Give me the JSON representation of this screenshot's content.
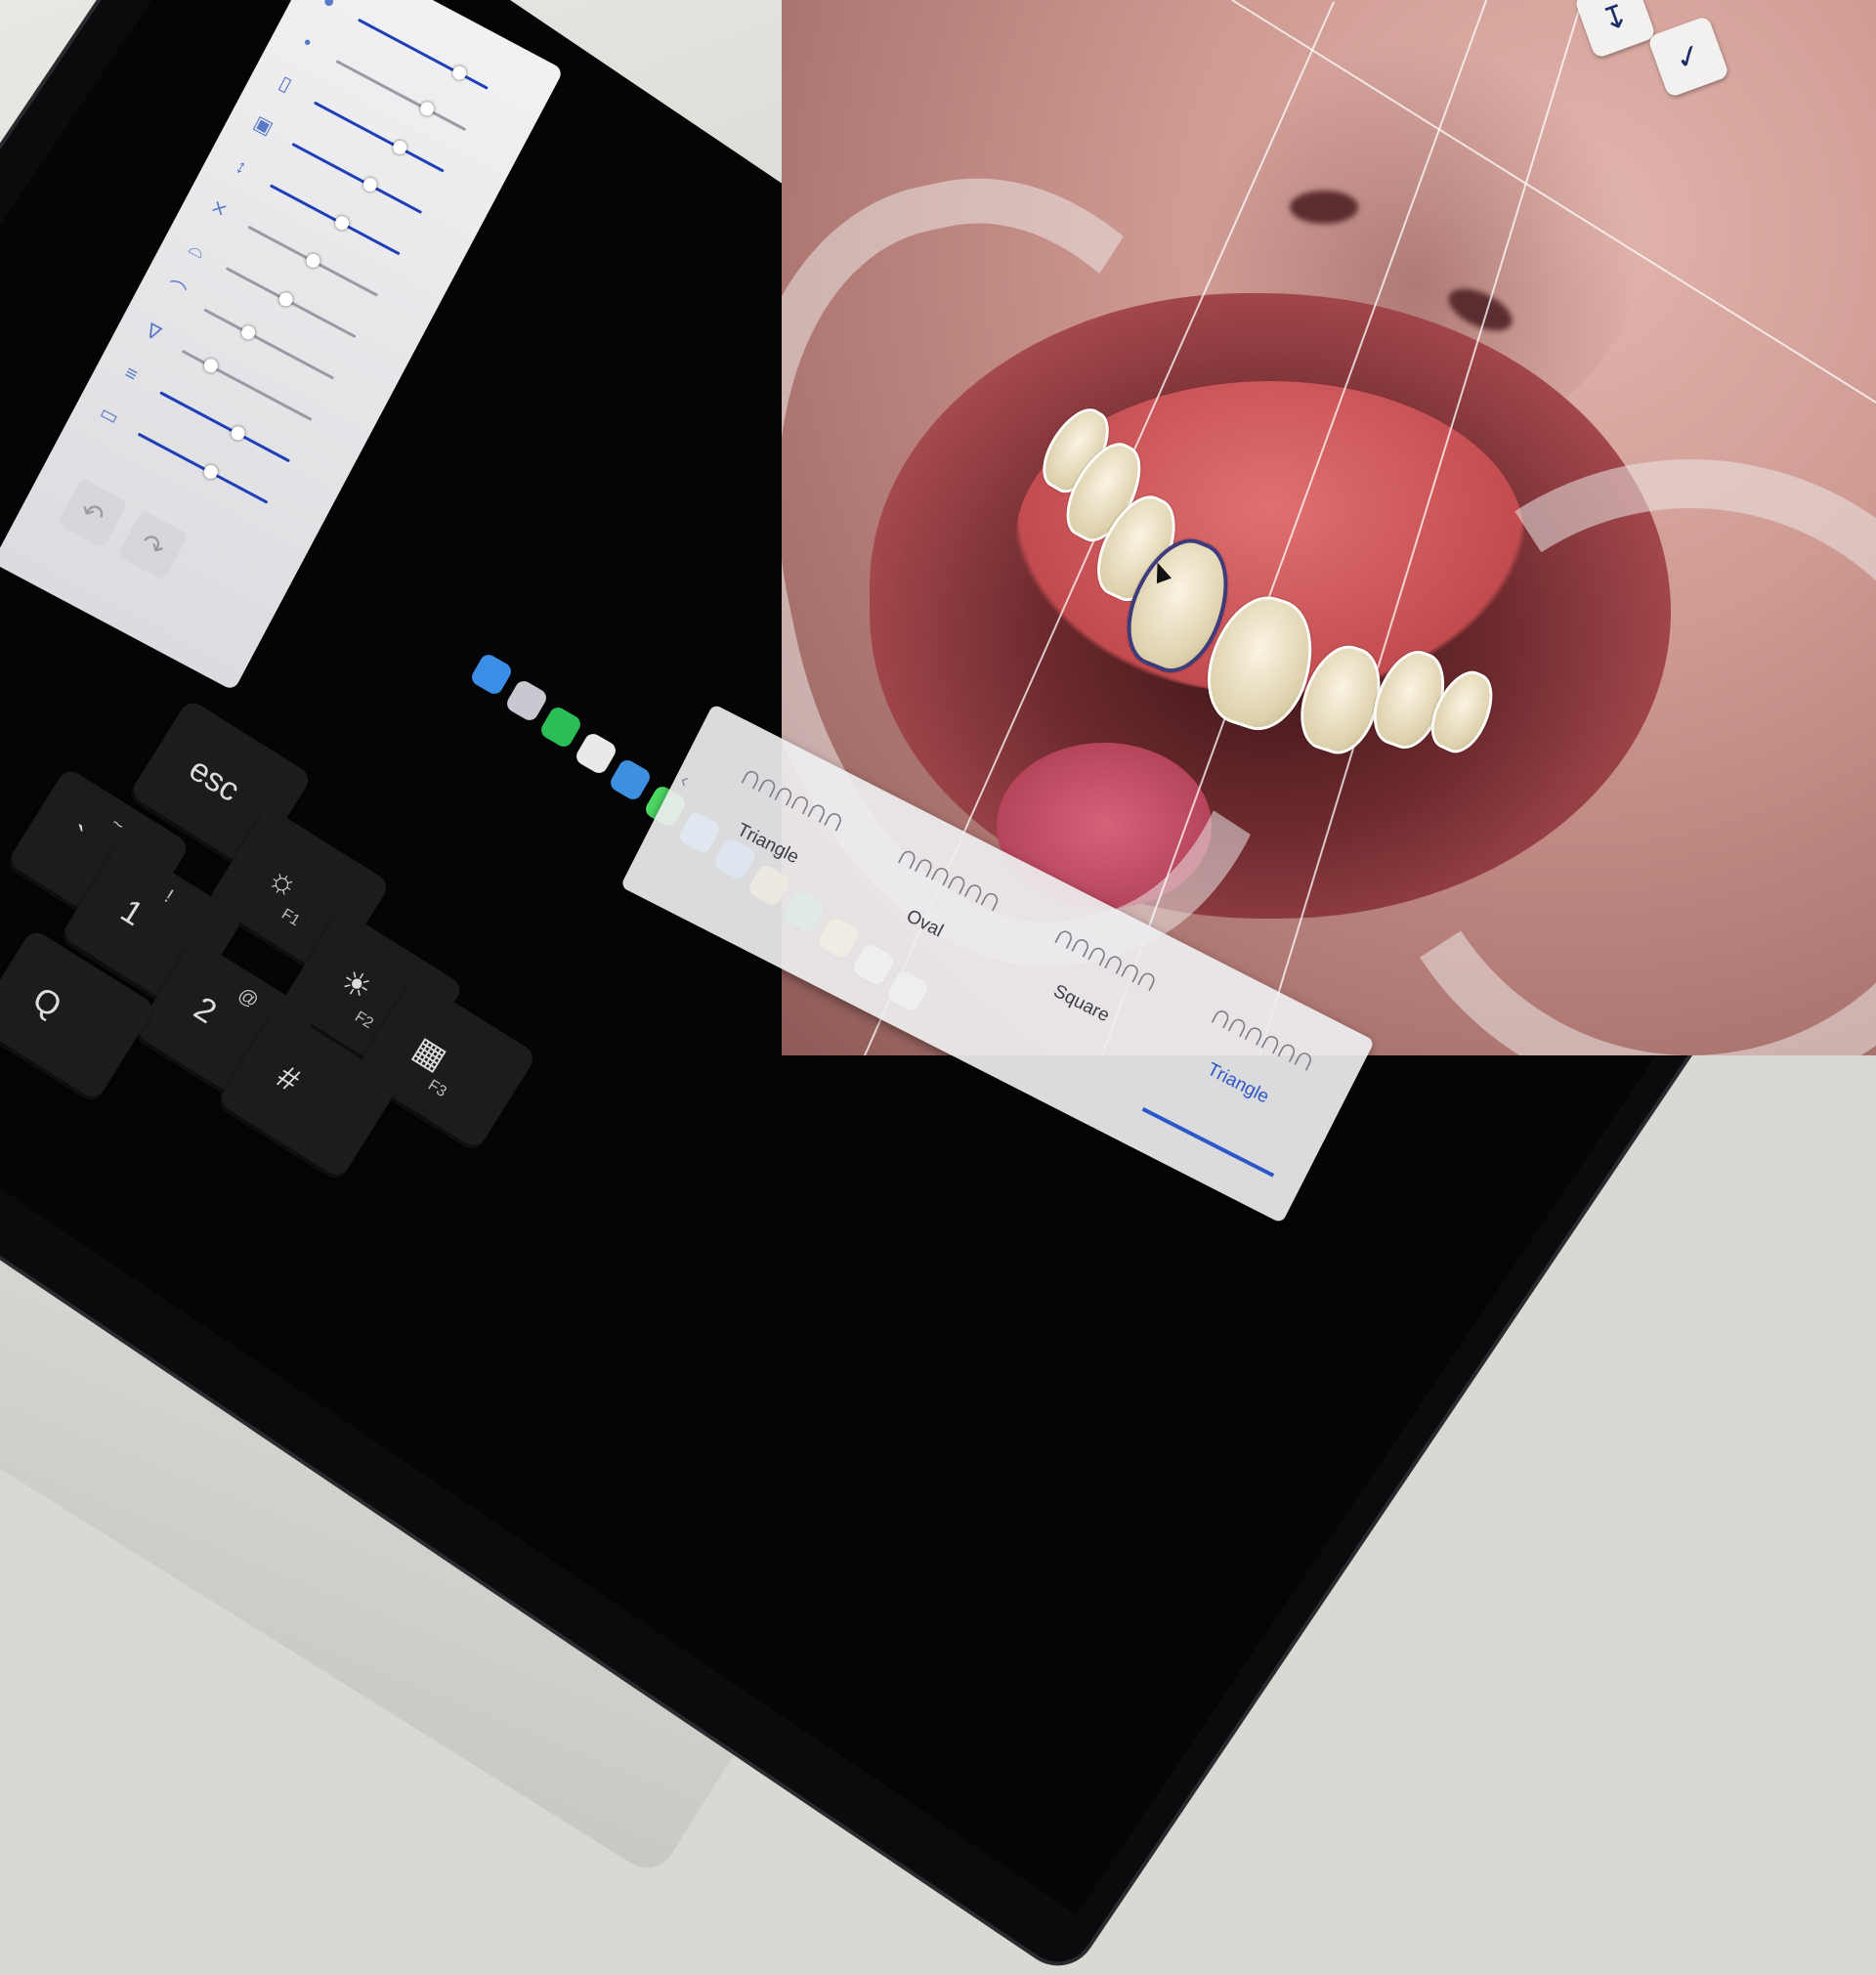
{
  "toolbar": {
    "buttons": [
      {
        "name": "ruler-icon",
        "glyph": "↧"
      },
      {
        "name": "clipboard-check-icon",
        "glyph": "✓"
      }
    ]
  },
  "panel": {
    "sliders": [
      {
        "name": "slider-1",
        "icon": "●",
        "level": 0.78,
        "active": true
      },
      {
        "name": "slider-2",
        "icon": "•",
        "level": 0.7,
        "active": false
      },
      {
        "name": "slider-3",
        "icon": "▯",
        "level": 0.66,
        "active": true
      },
      {
        "name": "slider-4",
        "icon": "▣",
        "level": 0.6,
        "active": true
      },
      {
        "name": "slider-5",
        "icon": "↕",
        "level": 0.55,
        "active": true
      },
      {
        "name": "slider-6",
        "icon": "⨯",
        "level": 0.5,
        "active": false
      },
      {
        "name": "slider-7",
        "icon": "⌓",
        "level": 0.46,
        "active": false
      },
      {
        "name": "slider-8",
        "icon": "⌒",
        "level": 0.34,
        "active": false
      },
      {
        "name": "slider-9",
        "icon": "∇",
        "level": 0.22,
        "active": false
      },
      {
        "name": "slider-10",
        "icon": "≡",
        "level": 0.6,
        "active": true
      },
      {
        "name": "slider-11",
        "icon": "▭",
        "level": 0.56,
        "active": true
      }
    ],
    "undo": "↶",
    "redo": "↷"
  },
  "dock": {
    "apps": [
      {
        "name": "finder-icon",
        "color": "#3a8ee6"
      },
      {
        "name": "launchpad-icon",
        "color": "#c8c8d0"
      },
      {
        "name": "whatsapp-icon",
        "color": "#2bbd56"
      },
      {
        "name": "chrome-icon",
        "color": "#e9e9e9"
      },
      {
        "name": "safari-icon",
        "color": "#3d8fe0"
      },
      {
        "name": "messages-icon",
        "color": "#4cd964"
      },
      {
        "name": "mail-icon",
        "color": "#4f9ef0"
      },
      {
        "name": "app-store-icon",
        "color": "#3a7fe5"
      },
      {
        "name": "photos-icon",
        "color": "#f0b030"
      },
      {
        "name": "facetime-icon",
        "color": "#3ccb5a"
      },
      {
        "name": "notes-icon",
        "color": "#f7d05a"
      },
      {
        "name": "reminders-icon",
        "color": "#f4f4f4"
      },
      {
        "name": "activity-monitor-icon",
        "color": "#f2f2f2"
      }
    ]
  },
  "tooth_picker": {
    "shapes": [
      {
        "label": "Triangle",
        "selected": false
      },
      {
        "label": "Oval",
        "selected": false
      },
      {
        "label": "Square",
        "selected": false
      },
      {
        "label": "Triangle",
        "selected": true
      }
    ],
    "arrow": "‹"
  },
  "keyboard": {
    "keys": [
      {
        "name": "key-esc",
        "main": "esc",
        "sub": "",
        "fn": ""
      },
      {
        "name": "key-tilde",
        "main": "`",
        "sub": "~",
        "fn": ""
      },
      {
        "name": "key-f1",
        "main": "☼",
        "sub": "",
        "fn": "F1"
      },
      {
        "name": "key-1",
        "main": "1",
        "sub": "!",
        "fn": ""
      },
      {
        "name": "key-f2",
        "main": "☀",
        "sub": "",
        "fn": "F2"
      },
      {
        "name": "key-2",
        "main": "2",
        "sub": "@",
        "fn": ""
      },
      {
        "name": "key-f3",
        "main": "▦",
        "sub": "",
        "fn": "F3"
      },
      {
        "name": "key-q",
        "main": "Q",
        "sub": "",
        "fn": ""
      },
      {
        "name": "key-3",
        "main": "#",
        "sub": "",
        "fn": ""
      }
    ]
  }
}
